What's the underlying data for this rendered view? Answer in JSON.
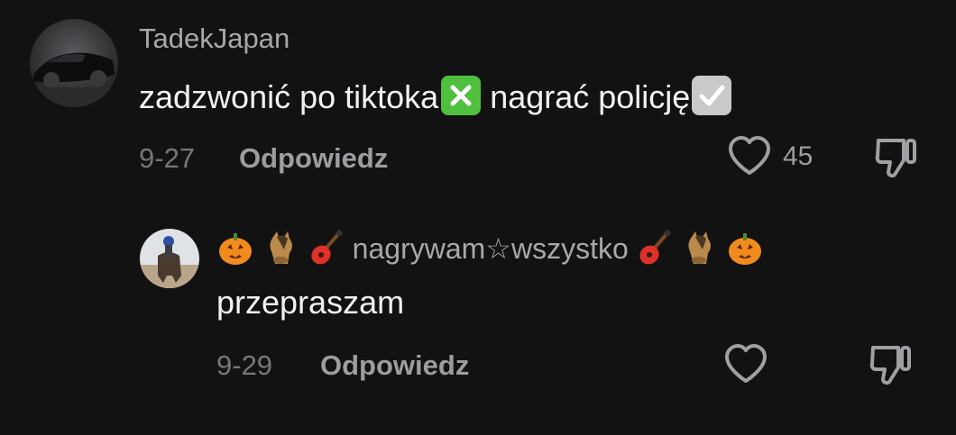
{
  "comments": [
    {
      "username": "TadekJapan",
      "text_part1": "zadzwonić po tiktoka",
      "emoji1": "cross-mark-button",
      "text_part2": " nagrać policję",
      "emoji2": "check-box-with-check",
      "date": "9-27",
      "reply_label": "Odpowiedz",
      "like_count": "45"
    },
    {
      "username_prefix_emojis": [
        "jack-o-lantern",
        "horse-face",
        "guitar"
      ],
      "username": "nagrywam☆wszystko",
      "username_suffix_emojis": [
        "guitar",
        "horse-face",
        "jack-o-lantern"
      ],
      "text": "przepraszam",
      "date": "9-29",
      "reply_label": "Odpowiedz"
    }
  ],
  "colors": {
    "background": "#121212",
    "username": "#a8a8ac",
    "body_text": "#f2f2f2",
    "meta": "#77777b",
    "accent_green": "#4fbf3d"
  }
}
